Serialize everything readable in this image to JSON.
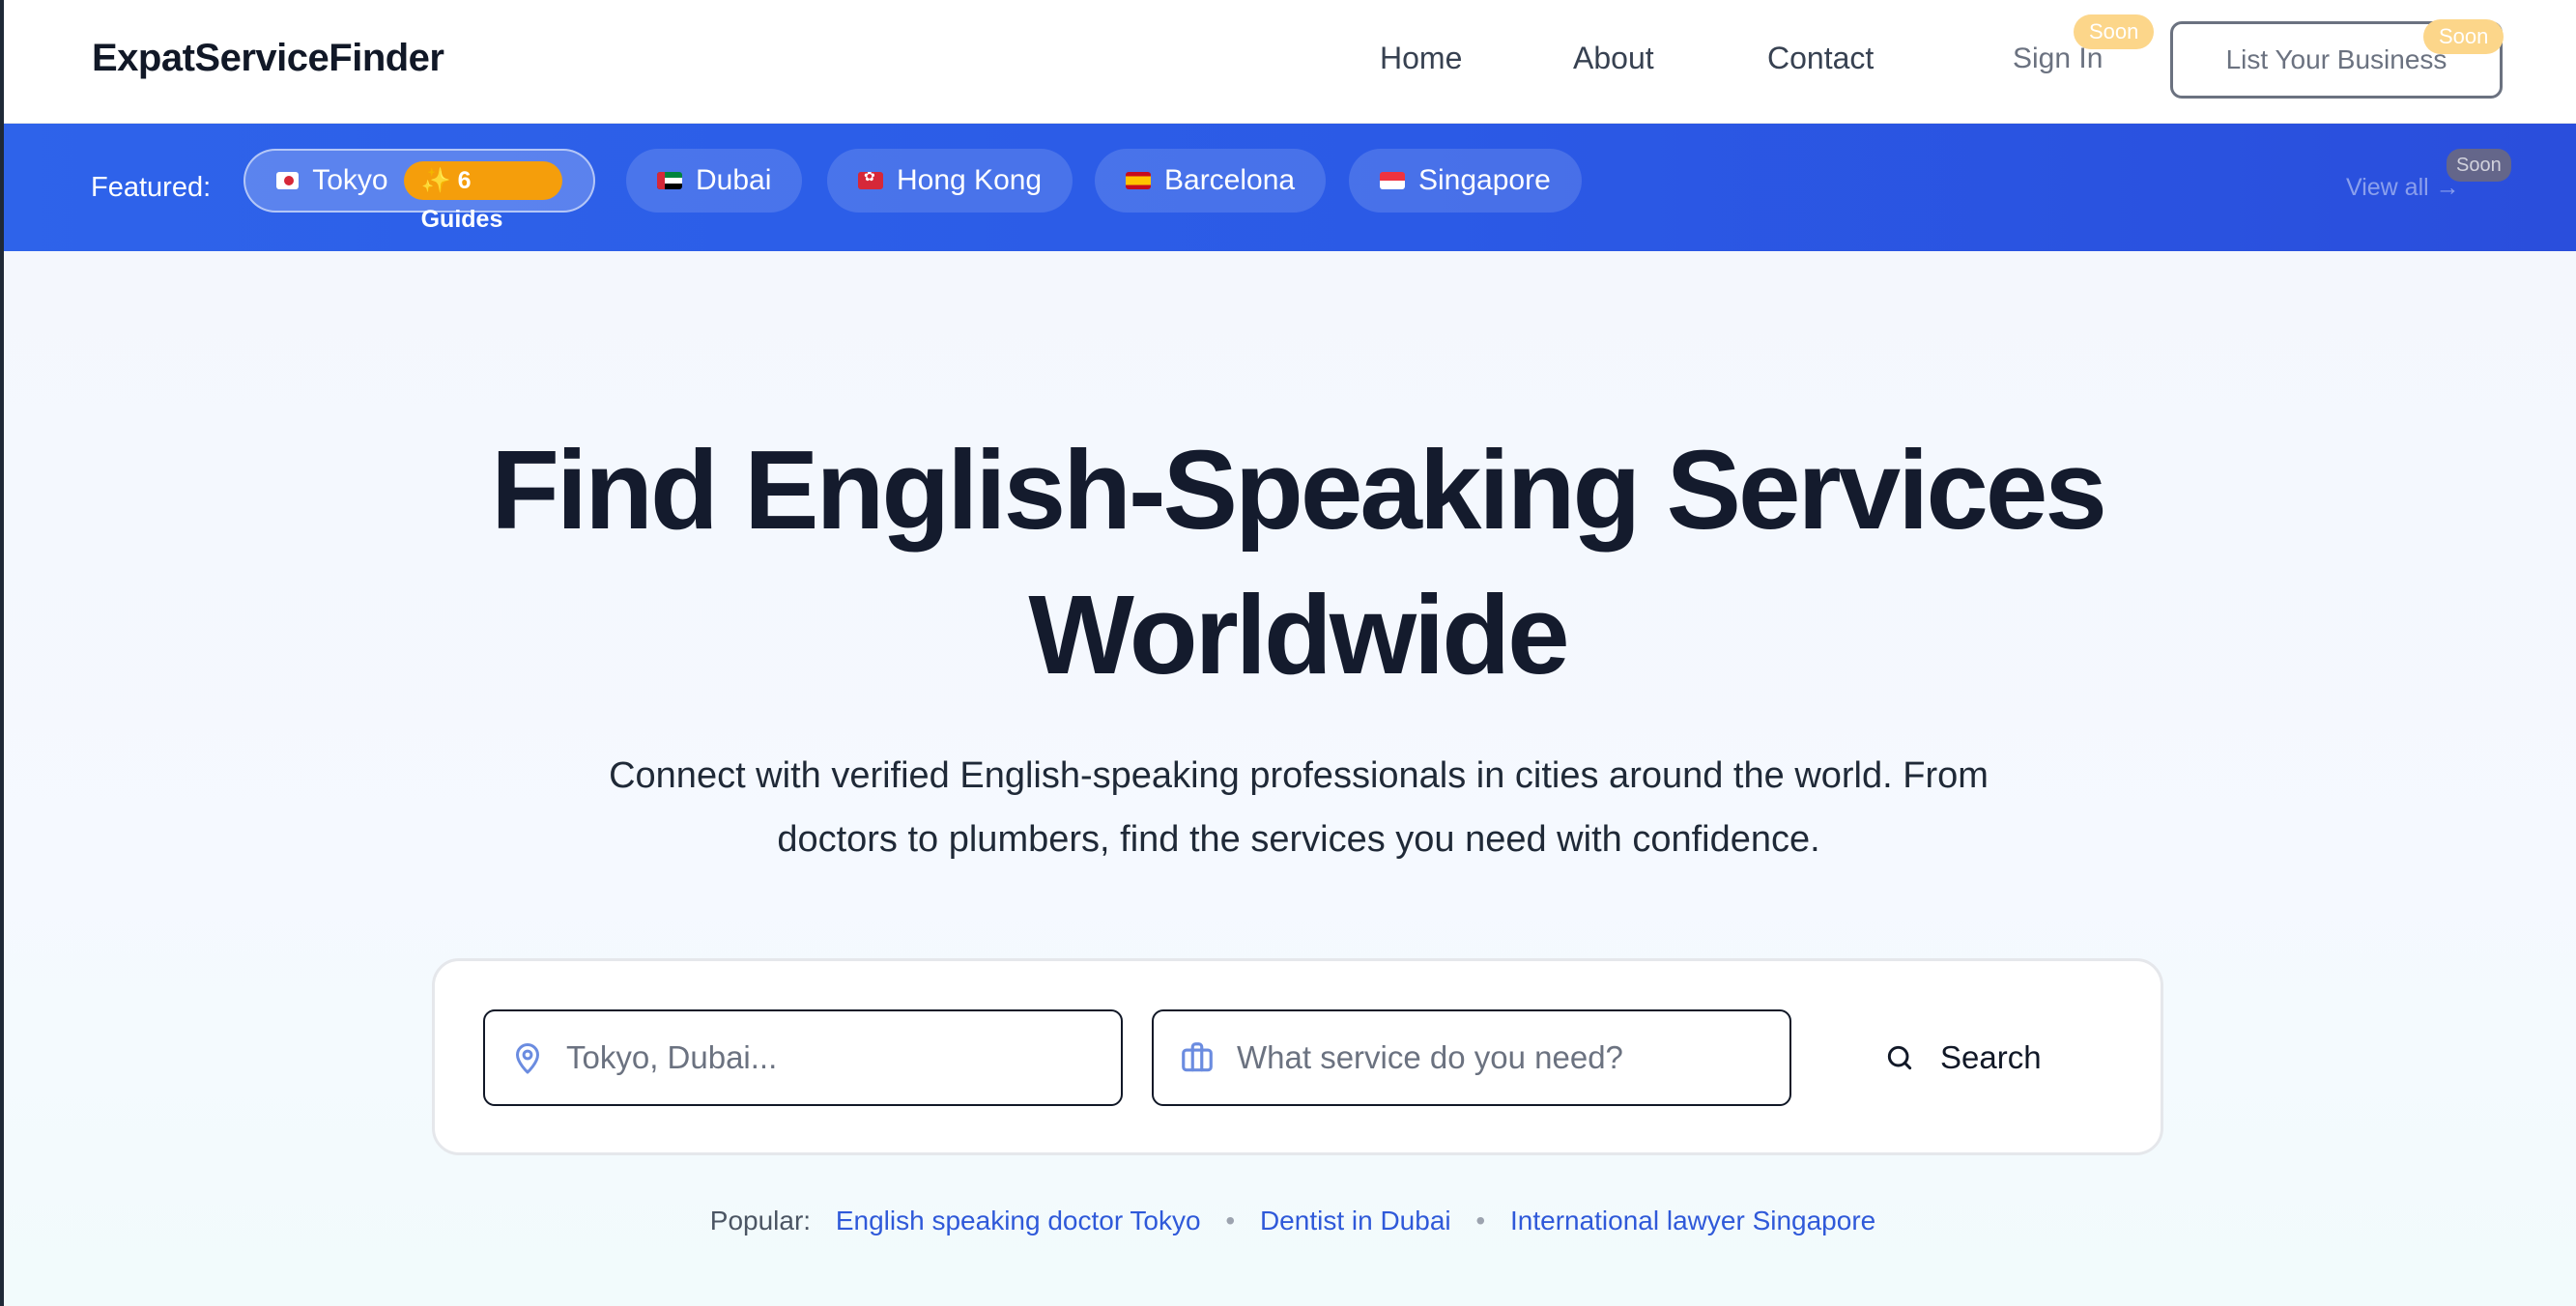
{
  "header": {
    "logo": "ExpatServiceFinder",
    "nav": {
      "home": "Home",
      "about": "About",
      "contact": "Contact"
    },
    "sign_in": "Sign In",
    "sign_in_badge": "Soon",
    "list_business": "List Your Business",
    "list_business_badge": "Soon"
  },
  "featured": {
    "label": "Featured:",
    "cities": [
      {
        "name": "Tokyo",
        "flag": "japan-flag-icon",
        "badge": "✨ 6 Guides",
        "active": true
      },
      {
        "name": "Dubai",
        "flag": "uae-flag-icon"
      },
      {
        "name": "Hong Kong",
        "flag": "hong-kong-flag-icon"
      },
      {
        "name": "Barcelona",
        "flag": "spain-flag-icon"
      },
      {
        "name": "Singapore",
        "flag": "singapore-flag-icon"
      }
    ],
    "view_all": "View all",
    "view_all_badge": "Soon"
  },
  "hero": {
    "title_line1": "Find English-Speaking Services",
    "title_line2": "Worldwide",
    "subtitle_line1": "Connect with verified English-speaking professionals in cities around the world. From",
    "subtitle_line2": "doctors to plumbers, find the services you need with confidence."
  },
  "search": {
    "location_placeholder": "Tokyo, Dubai...",
    "service_placeholder": "What service do you need?",
    "button_label": "Search",
    "location_icon": "map-pin-icon",
    "service_icon": "briefcase-icon",
    "search_icon": "search-icon"
  },
  "popular": {
    "label": "Popular:",
    "links": [
      "English speaking doctor Tokyo",
      "Dentist in Dubai",
      "International lawyer Singapore"
    ]
  },
  "colors": {
    "brand_blue": "#2e63ea",
    "badge_amber": "#f59e0b",
    "soon_badge": "#fcd68a",
    "link_blue": "#2f59d9"
  }
}
